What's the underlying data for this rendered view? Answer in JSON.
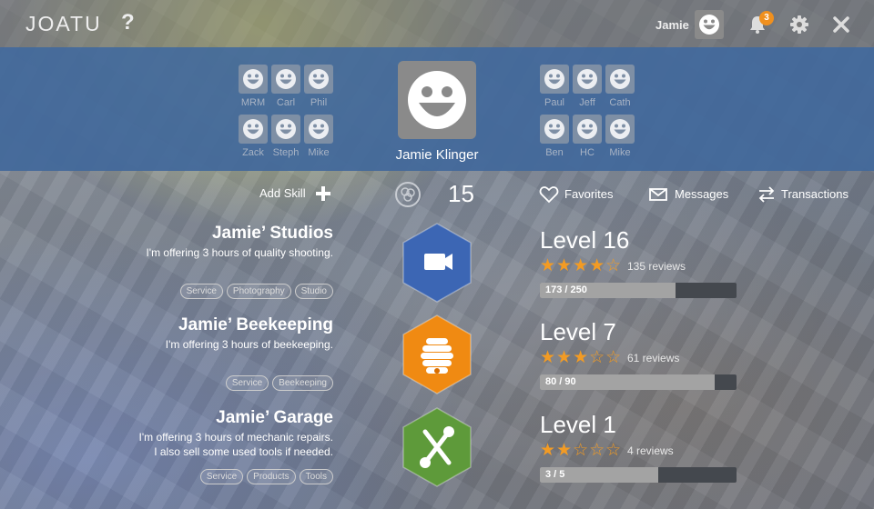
{
  "topbar": {
    "logo": "JOATU",
    "help": "?",
    "username": "Jamie",
    "notification_count": "3"
  },
  "profile": {
    "name": "Jamie Klinger",
    "friends_left": [
      "MRM",
      "Carl",
      "Phil",
      "Zack",
      "Steph",
      "Mike"
    ],
    "friends_right": [
      "Paul",
      "Jeff",
      "Cath",
      "Ben",
      "HC",
      "Mike"
    ]
  },
  "actions": {
    "add_skill": "Add Skill",
    "count": "15",
    "favorites": "Favorites",
    "messages": "Messages",
    "transactions": "Transactions"
  },
  "skills": [
    {
      "title": "Jamie’ Studios",
      "desc": [
        "I'm offering 3 hours of quality shooting."
      ],
      "tags": [
        "Service",
        "Photography",
        "Studio"
      ],
      "icon": "video-camera-icon",
      "color": "#3c66b4",
      "level": "Level 16",
      "rating": 4,
      "reviews": "135 reviews",
      "progress_text": "173 / 250",
      "progress": 0.692
    },
    {
      "title": "Jamie’ Beekeeping",
      "desc": [
        "I'm offering 3 hours of beekeeping."
      ],
      "tags": [
        "Service",
        "Beekeeping"
      ],
      "icon": "beehive-icon",
      "color": "#f08a12",
      "level": "Level 7",
      "rating": 3,
      "reviews": "61 reviews",
      "progress_text": "80 / 90",
      "progress": 0.889
    },
    {
      "title": "Jamie’ Garage",
      "desc": [
        "I'm offering 3 hours of mechanic repairs.",
        "I also sell some used tools if needed."
      ],
      "tags": [
        "Service",
        "Products",
        "Tools"
      ],
      "icon": "wrench-screwdriver-icon",
      "color": "#5e9a3a",
      "level": "Level 1",
      "rating": 2,
      "reviews": "4 reviews",
      "progress_text": "3 / 5",
      "progress": 0.6
    }
  ]
}
